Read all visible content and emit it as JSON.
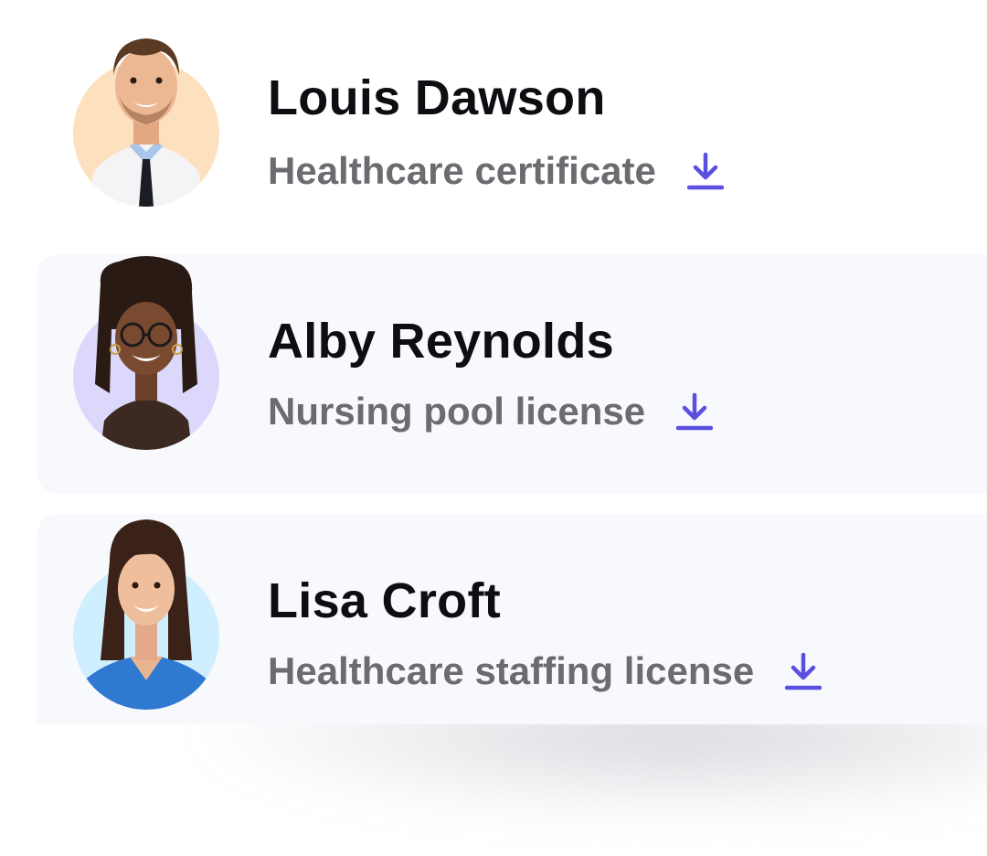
{
  "people": [
    {
      "name": "Louis Dawson",
      "document": "Healthcare certificate",
      "download_icon": "download-icon",
      "avatar_bg": "#fde0bd"
    },
    {
      "name": "Alby Reynolds",
      "document": "Nursing pool license",
      "download_icon": "download-icon",
      "avatar_bg": "#dcd8fb"
    },
    {
      "name": "Lisa Croft",
      "document": "Healthcare staffing license",
      "download_icon": "download-icon",
      "avatar_bg": "#cfeefe"
    }
  ],
  "colors": {
    "accent": "#5b4fe0",
    "name_text": "#0d0d12",
    "subtitle_text": "#6b6b70",
    "card_tint": "#f8f9fd"
  }
}
